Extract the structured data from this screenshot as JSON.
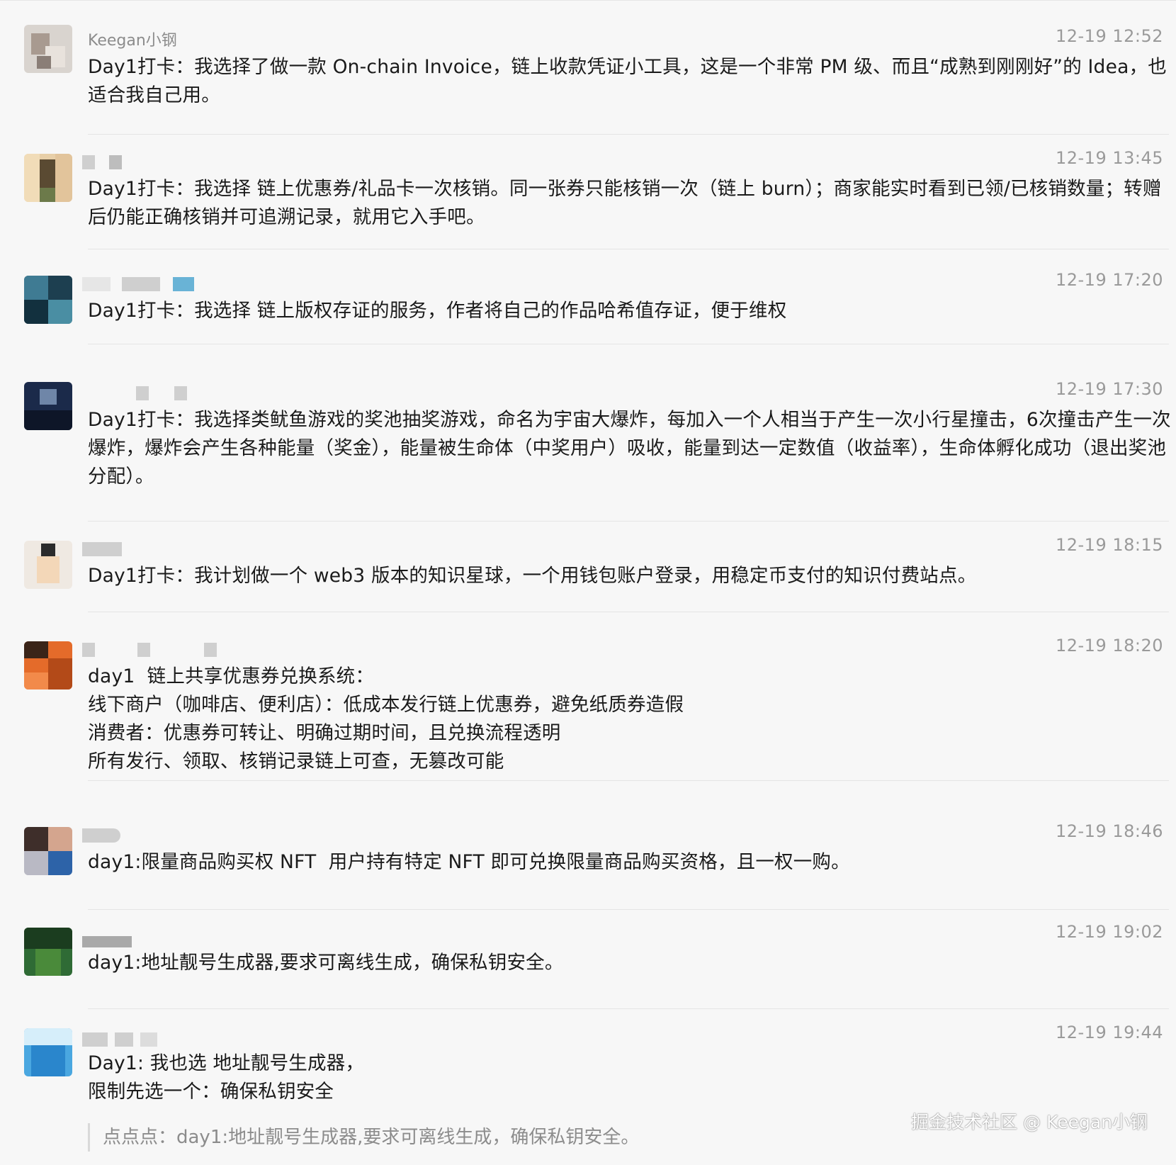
{
  "messages": [
    {
      "name": "Keegan小钢",
      "time": "12-19 12:52",
      "text": "Day1打卡：我选择了做一款 On-chain Invoice，链上收款凭证小工具，这是一个非常 PM 级、而且“成熟到刚刚好”的 Idea，也适合我自己用。"
    },
    {
      "name": "",
      "time": "12-19 13:45",
      "text": "Day1打卡：我选择 链上优惠券/礼品卡一次核销。同一张券只能核销一次（链上 burn）；商家能实时看到已领/已核销数量；转赠后仍能正确核销并可追溯记录，就用它入手吧。"
    },
    {
      "name": "",
      "time": "12-19 17:20",
      "text": "Day1打卡：我选择 链上版权存证的服务，作者将自己的作品哈希值存证，便于维权"
    },
    {
      "name": "",
      "time": "12-19 17:30",
      "text": "Day1打卡：我选择类鱿鱼游戏的奖池抽奖游戏，命名为宇宙大爆炸，每加入一个人相当于产生一次小行星撞击，6次撞击产生一次爆炸，爆炸会产生各种能量（奖金），能量被生命体（中奖用户）吸收，能量到达一定数值（收益率），生命体孵化成功（退出奖池分配）。"
    },
    {
      "name": "",
      "time": "12-19 18:15",
      "text": "Day1打卡：我计划做一个 web3 版本的知识星球，一个用钱包账户登录，用稳定币支付的知识付费站点。"
    },
    {
      "name": "",
      "time": "12-19 18:20",
      "text": "day1  链上共享优惠券兑换系统：\n线下商户（咖啡店、便利店）：低成本发行链上优惠券，避免纸质券造假\n消费者：优惠券可转让、明确过期时间，且兑换流程透明\n所有发行、领取、核销记录链上可查，无篡改可能"
    },
    {
      "name": "",
      "time": "12-19 18:46",
      "text": "day1:限量商品购买权 NFT  用户持有特定 NFT 即可兑换限量商品购买资格，且一权一购。"
    },
    {
      "name": "",
      "time": "12-19 19:02",
      "text": "day1:地址靓号生成器,要求可离线生成，确保私钥安全。"
    },
    {
      "name": "",
      "time": "12-19 19:44",
      "text": "Day1: 我也选 地址靓号生成器，\n限制先选一个：确保私钥安全",
      "quote": "点点点：day1:地址靓号生成器,要求可离线生成，确保私钥安全。"
    }
  ],
  "watermark": "掘金技术社区 @ Keegan小钢",
  "colors": {
    "background": "#f7f7f7",
    "text": "#1a1a1a",
    "meta": "#9a9a9a",
    "divider": "#e5e5e5"
  }
}
